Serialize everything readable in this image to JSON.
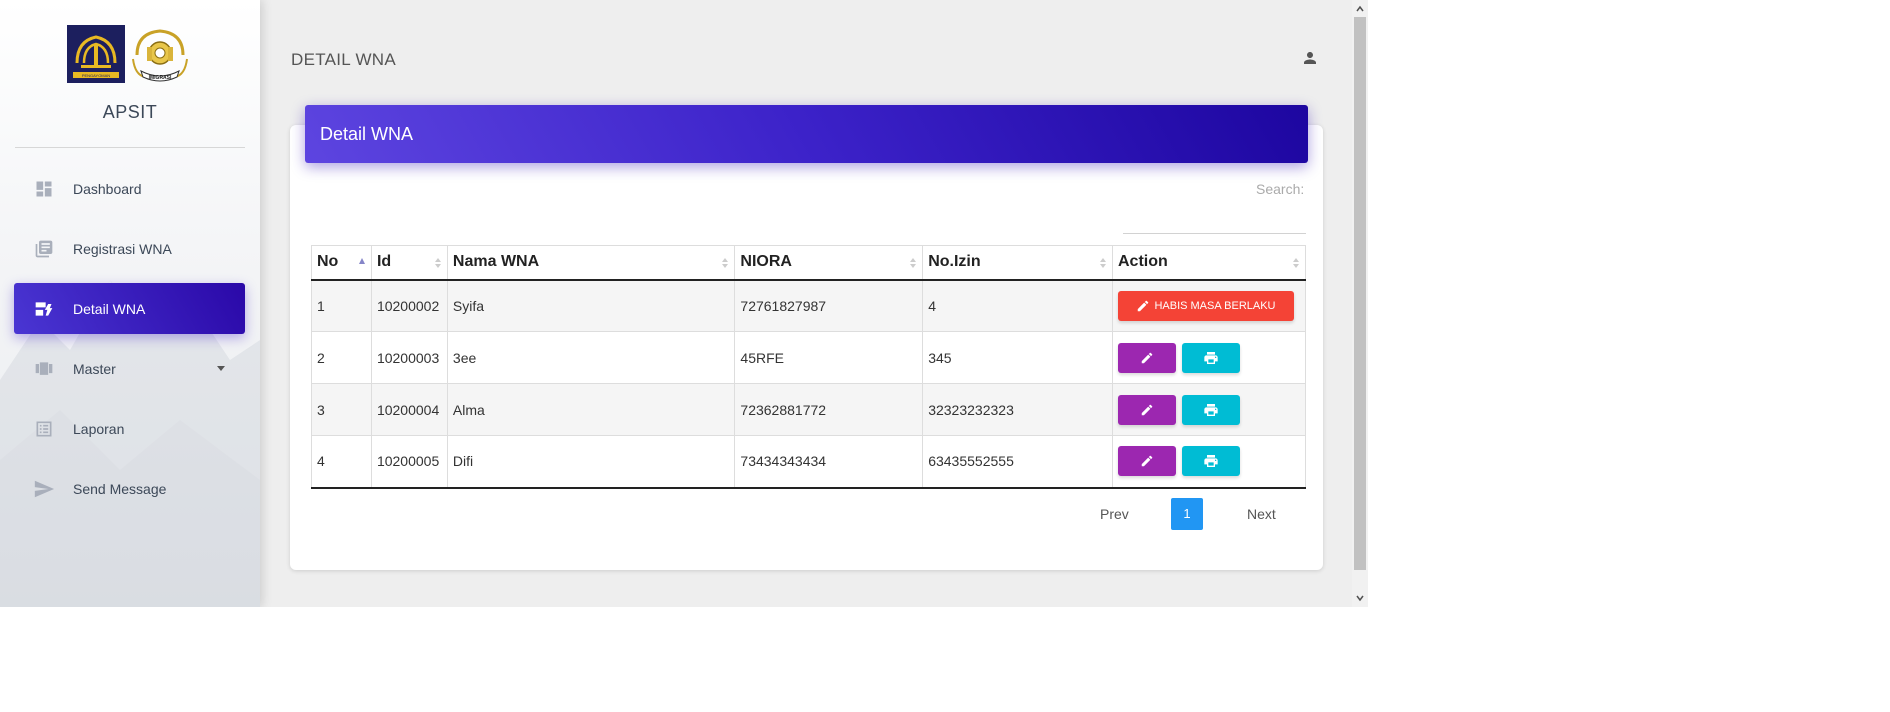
{
  "app": {
    "brand": "APSIT",
    "page_title": "DETAIL WNA"
  },
  "sidebar": {
    "items": [
      {
        "label": "Dashboard",
        "icon": "dashboard-icon"
      },
      {
        "label": "Registrasi WNA",
        "icon": "library-books-icon"
      },
      {
        "label": "Detail WNA",
        "icon": "dynamic-feed-icon",
        "active": true
      },
      {
        "label": "Master",
        "icon": "view-carousel-icon"
      },
      {
        "label": "Laporan",
        "icon": "list-icon"
      },
      {
        "label": "Send Message",
        "icon": "send-icon"
      }
    ]
  },
  "card": {
    "header": "Detail WNA",
    "search_label": "Search:",
    "search_value": ""
  },
  "table": {
    "columns": [
      "No",
      "Id",
      "Nama WNA",
      "NIORA",
      "No.Izin",
      "Action"
    ],
    "rows": [
      {
        "no": "1",
        "id": "10200002",
        "nama": "Syifa",
        "niora": "72761827987",
        "izin": "4",
        "action": "HABIS MASA BERLAKU"
      },
      {
        "no": "2",
        "id": "10200003",
        "nama": "3ee",
        "niora": "45RFE",
        "izin": "345",
        "action": ""
      },
      {
        "no": "3",
        "id": "10200004",
        "nama": "Alma",
        "niora": "72362881772",
        "izin": "32323232323",
        "action": ""
      },
      {
        "no": "4",
        "id": "10200005",
        "nama": "Difi",
        "niora": "73434343434",
        "izin": "63435552555",
        "action": ""
      }
    ]
  },
  "pagination": {
    "prev": "Prev",
    "current": "1",
    "next": "Next"
  },
  "colors": {
    "accent": "#3c22c9",
    "danger": "#f44336",
    "purple": "#9c27b0",
    "cyan": "#00bcd4",
    "page_active": "#2196f3"
  },
  "logos": {
    "pengayoman": "PENGAYOMAN",
    "imigrasi": "IMIGRASI"
  }
}
